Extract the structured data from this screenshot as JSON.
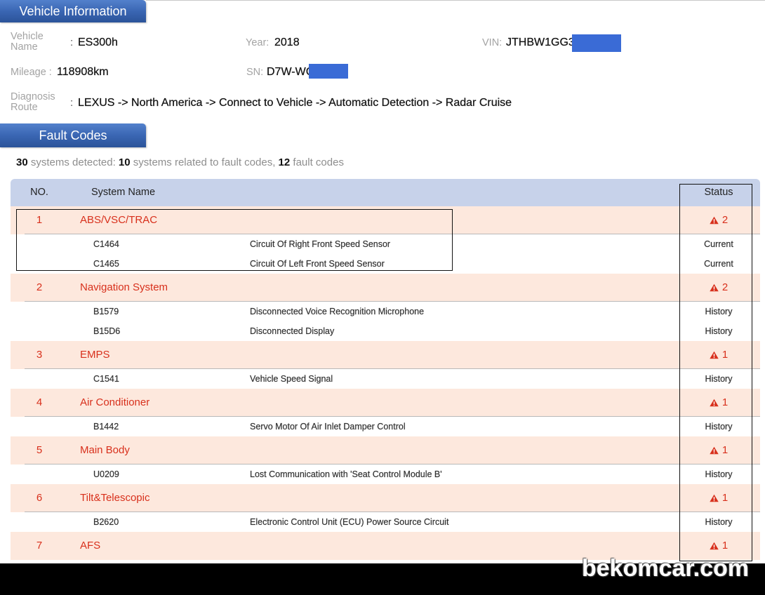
{
  "colors": {
    "section_tab": "#3a66b3",
    "fault_red": "#d8301c",
    "system_row": "#fde8dd",
    "table_header": "#c7d2ea",
    "redaction": "#3a6bd6"
  },
  "icons": {
    "status": "warning-icon"
  },
  "vehicle_info": {
    "title": "Vehicle Information",
    "name_label": "Vehicle Name",
    "name_separator": ":",
    "name_value": "ES300h",
    "year_label": "Year:",
    "year_value": "2018",
    "vin_label": "VIN:",
    "vin_value": "JTHBW1GG3J",
    "mileage_label": "Mileage :",
    "mileage_value": "118908km",
    "sn_label": "SN:",
    "sn_value": "D7W-WC",
    "route_label": "Diagnosis Route",
    "route_separator": ":",
    "route_value": "LEXUS -> North America -> Connect to Vehicle -> Automatic Detection -> Radar Cruise"
  },
  "fault_codes": {
    "title": "Fault Codes",
    "summary": {
      "systems_detected": 30,
      "systems_detected_text": " systems detected: ",
      "systems_with_faults": 10,
      "systems_with_faults_text": " systems related to fault codes, ",
      "fault_code_count": 12,
      "fault_code_count_text": " fault codes"
    },
    "columns": {
      "no": "NO.",
      "system_name": "System Name",
      "status": "Status"
    },
    "systems": [
      {
        "no": 1,
        "name": "ABS/VSC/TRAC",
        "count": 2,
        "codes": [
          {
            "code": "C1464",
            "description": "Circuit Of Right Front Speed Sensor",
            "status": "Current"
          },
          {
            "code": "C1465",
            "description": "Circuit Of Left Front Speed Sensor",
            "status": "Current"
          }
        ]
      },
      {
        "no": 2,
        "name": "Navigation System",
        "count": 2,
        "codes": [
          {
            "code": "B1579",
            "description": "Disconnected Voice Recognition Microphone",
            "status": "History"
          },
          {
            "code": "B15D6",
            "description": "Disconnected Display",
            "status": "History"
          }
        ]
      },
      {
        "no": 3,
        "name": "EMPS",
        "count": 1,
        "codes": [
          {
            "code": "C1541",
            "description": "Vehicle Speed Signal",
            "status": "History"
          }
        ]
      },
      {
        "no": 4,
        "name": "Air Conditioner",
        "count": 1,
        "codes": [
          {
            "code": "B1442",
            "description": "Servo Motor Of Air Inlet Damper Control",
            "status": "History"
          }
        ]
      },
      {
        "no": 5,
        "name": "Main Body",
        "count": 1,
        "codes": [
          {
            "code": "U0209",
            "description": "Lost Communication with 'Seat Control Module B'",
            "status": "History"
          }
        ]
      },
      {
        "no": 6,
        "name": "Tilt&Telescopic",
        "count": 1,
        "codes": [
          {
            "code": "B2620",
            "description": "Electronic Control Unit (ECU) Power Source Circuit",
            "status": "History"
          }
        ]
      },
      {
        "no": 7,
        "name": "AFS",
        "count": 1,
        "codes": []
      }
    ]
  },
  "watermark": {
    "text": "bekomcar.com"
  }
}
